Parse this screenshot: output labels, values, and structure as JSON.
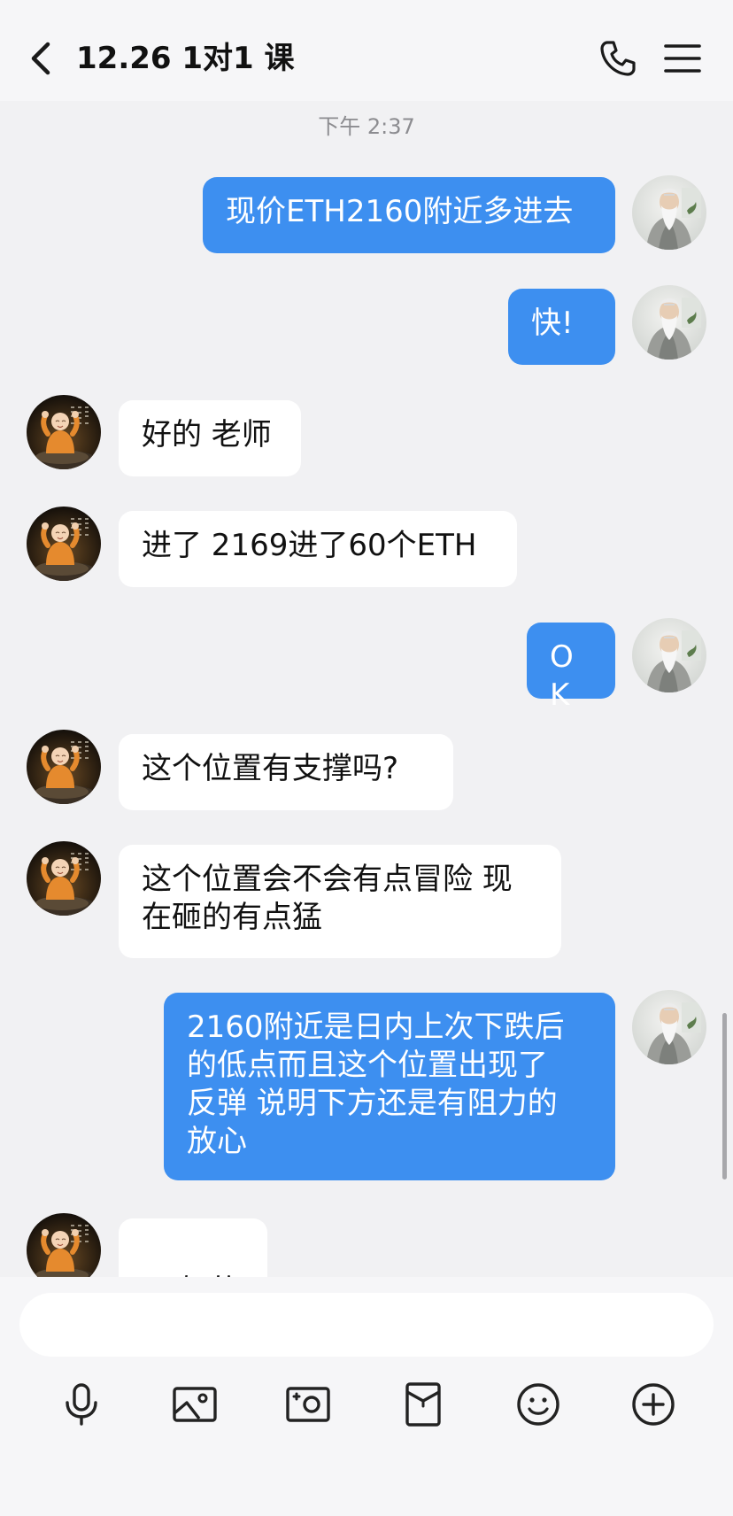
{
  "header": {
    "title": "12.26 1对1 课",
    "back_icon": "chevron-left-icon",
    "phone_icon": "phone-icon",
    "menu_icon": "hamburger-menu-icon"
  },
  "chat": {
    "timestamp": "下午 2:37",
    "messages": [
      {
        "side": "out",
        "text": "现价ETH2160附近多进去"
      },
      {
        "side": "out",
        "text": "快!"
      },
      {
        "side": "in",
        "text": "好的 老师"
      },
      {
        "side": "in",
        "text": "进了 2169进了60个ETH"
      },
      {
        "side": "out",
        "text": "OK"
      },
      {
        "side": "in",
        "text": "这个位置有支撑吗?"
      },
      {
        "side": "in",
        "text": "这个位置会不会有点冒险 现\n在砸的有点猛"
      },
      {
        "side": "out",
        "text": "2160附近是日内上次下跌后\n的低点而且这个位置出现了\n反弹 说明下方还是有阻力的\n放心"
      },
      {
        "side": "in",
        "text": "好的",
        "emoji": "ok-hand-icon"
      }
    ]
  },
  "input": {
    "value": "",
    "placeholder": ""
  },
  "toolbar": {
    "icons": [
      "microphone-icon",
      "image-icon",
      "camera-icon",
      "red-packet-icon",
      "emoji-icon",
      "plus-icon"
    ]
  },
  "colors": {
    "outgoing_bubble": "#3d8ff0",
    "incoming_bubble": "#ffffff",
    "background": "#f1f1f3"
  }
}
